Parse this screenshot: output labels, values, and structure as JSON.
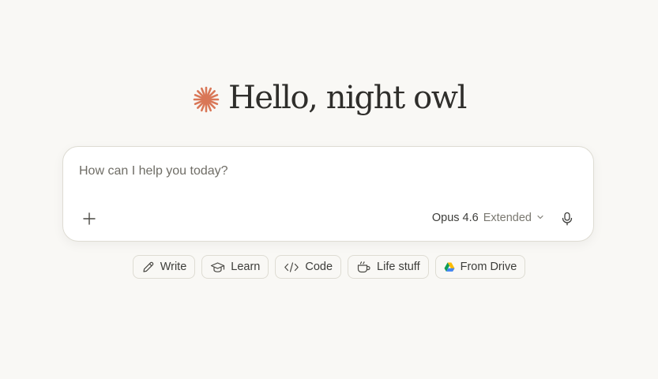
{
  "greeting": {
    "text": "Hello, night owl",
    "logo_icon": "spark-asterisk-icon",
    "accent_color": "#d97757"
  },
  "composer": {
    "placeholder": "How can I help you today?",
    "value": "",
    "attach_icon": "plus-icon",
    "model_name": "Opus 4.6",
    "model_mode": "Extended",
    "model_dropdown_icon": "chevron-down-icon",
    "voice_icon": "microphone-icon"
  },
  "suggestions": [
    {
      "label": "Write",
      "icon": "pencil-icon"
    },
    {
      "label": "Learn",
      "icon": "graduation-cap-icon"
    },
    {
      "label": "Code",
      "icon": "code-icon"
    },
    {
      "label": "Life stuff",
      "icon": "coffee-cup-icon"
    },
    {
      "label": "From Drive",
      "icon": "google-drive-icon"
    }
  ]
}
